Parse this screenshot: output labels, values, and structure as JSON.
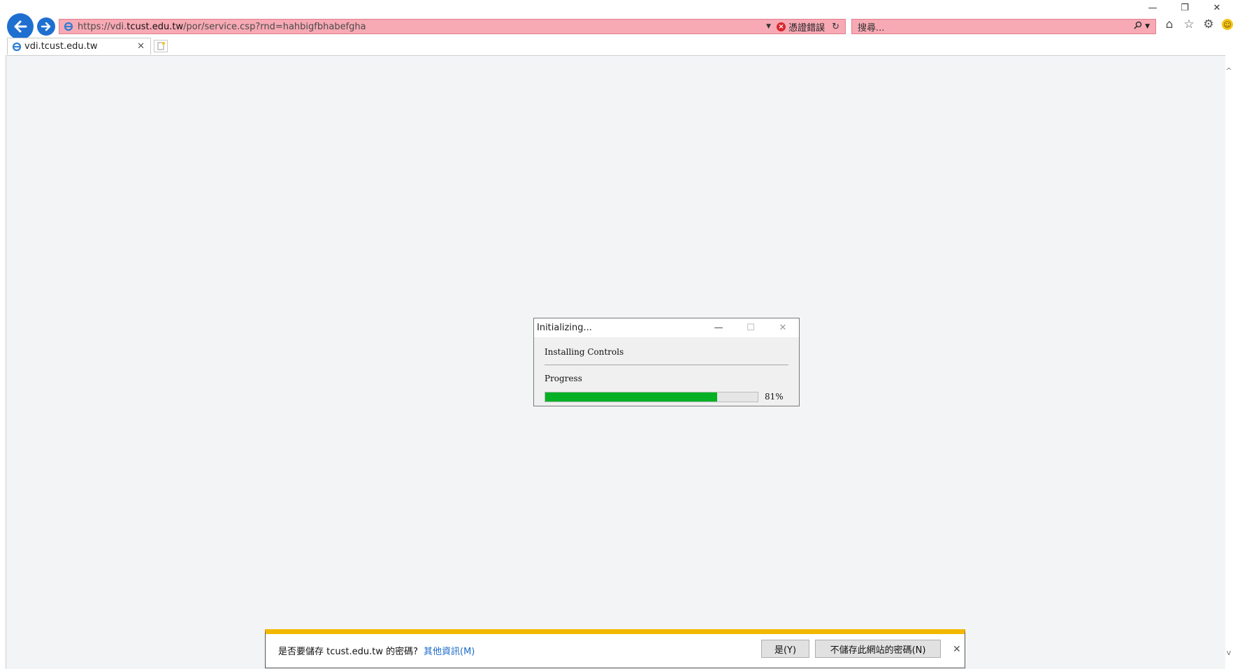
{
  "window": {
    "minimize_glyph": "—",
    "restore_glyph": "❐",
    "close_glyph": "✕"
  },
  "address_bar": {
    "url_prefix": "https://vdi.",
    "url_domain": "tcust.edu.tw",
    "url_suffix": "/por/service.csp?rnd=hahbigfbhabefgha",
    "cert_error": "憑證錯誤",
    "background_color": "#f7a9b4"
  },
  "search": {
    "placeholder": "搜尋..."
  },
  "tab": {
    "title": "vdi.tcust.edu.tw"
  },
  "dialog": {
    "title": "Initializing...",
    "status_label": "Installing Controls",
    "progress_label": "Progress",
    "progress_text": "81%",
    "progress_value": 0.81,
    "progress_color": "#06b025"
  },
  "notification": {
    "message": "是否要儲存 tcust.edu.tw 的密碼?",
    "more_info": "其他資訊(M)",
    "yes_button": "是(Y)",
    "no_button": "不儲存此網站的密碼(N)",
    "accent_color": "#f2b800"
  }
}
